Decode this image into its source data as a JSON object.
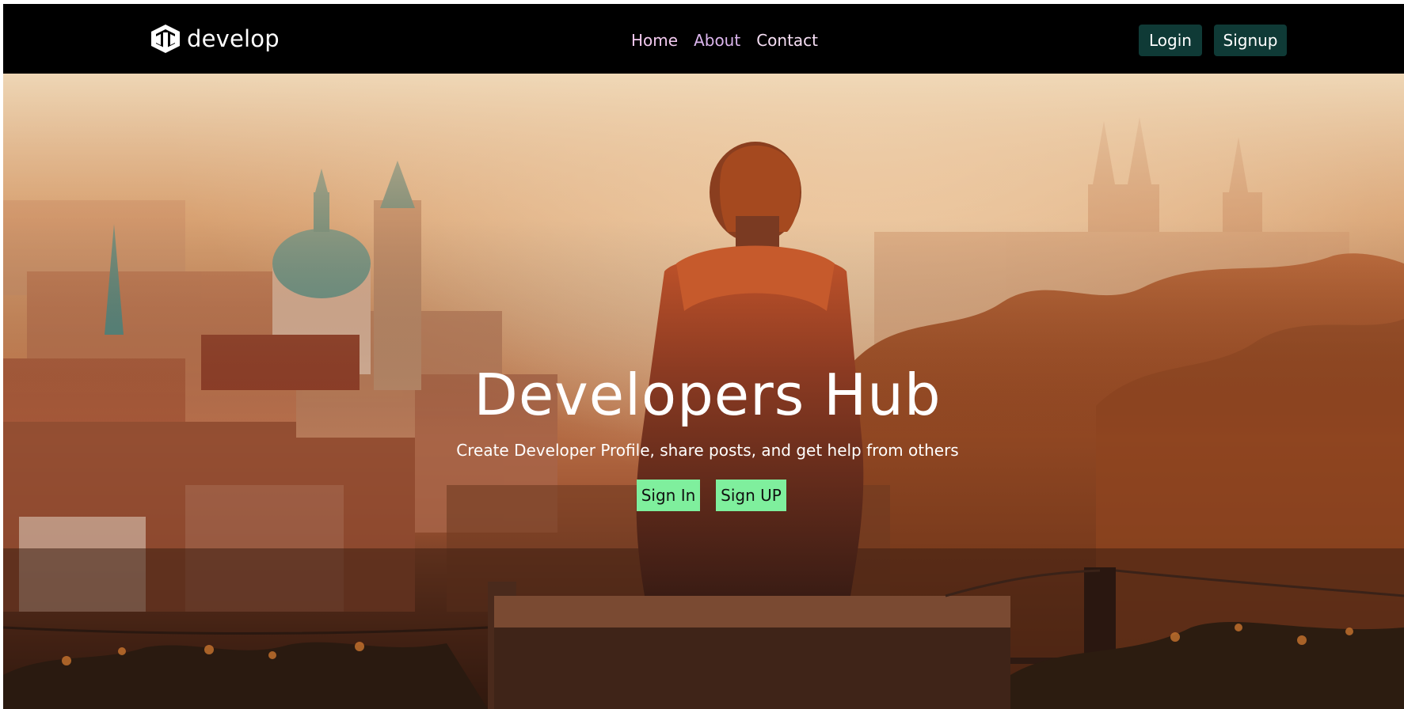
{
  "navbar": {
    "brand": "develop",
    "links": [
      "Home",
      "About",
      "Contact"
    ],
    "login_label": "Login",
    "signup_label": "Signup"
  },
  "hero": {
    "title": "Developers Hub",
    "subtitle": "Create Developer Profile, share posts, and get help from others",
    "signin_label": "Sign In",
    "signup_label": "Sign UP",
    "background_image": "person-sitting-on-bench-overlooking-city-at-sunset"
  },
  "colors": {
    "navbar_bg": "#000000",
    "auth_button_bg": "#0f3a36",
    "hero_button_bg": "#7fef9d",
    "nav_link": "#f2c9ef"
  },
  "icons": [
    "brand-logo-icon"
  ]
}
